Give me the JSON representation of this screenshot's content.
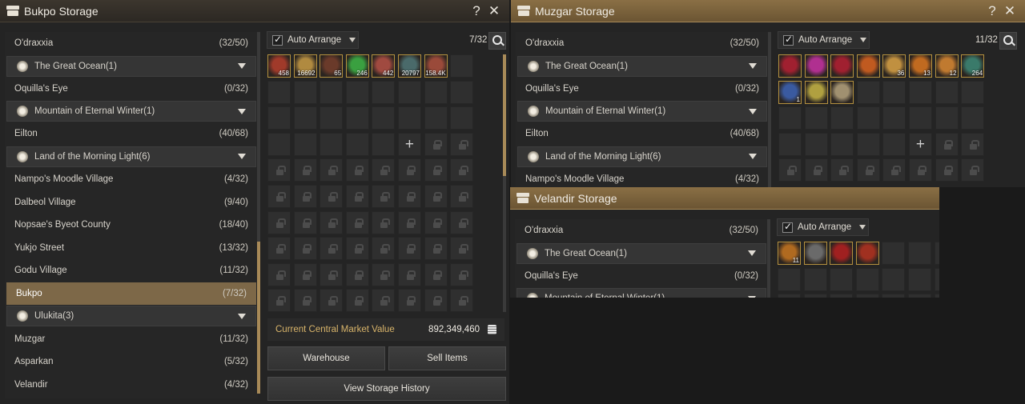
{
  "colors": {
    "accent_gold": "#a88a58",
    "selected_row": "#7d6848",
    "market_label": "#d8b46a"
  },
  "bukpo": {
    "title": "Bukpo Storage",
    "help_icon": "?",
    "close_icon": "✕",
    "rows": [
      {
        "type": "town",
        "name": "O'draxxia",
        "count": "(32/50)"
      },
      {
        "type": "region",
        "name": "The Great Ocean(1)"
      },
      {
        "type": "town",
        "name": "Oquilla's Eye",
        "count": "(0/32)"
      },
      {
        "type": "region",
        "name": "Mountain of Eternal Winter(1)"
      },
      {
        "type": "town",
        "name": "Eilton",
        "count": "(40/68)"
      },
      {
        "type": "region",
        "name": "Land of the Morning Light(6)"
      },
      {
        "type": "town",
        "name": "Nampo's Moodle Village",
        "count": "(4/32)"
      },
      {
        "type": "town",
        "name": "Dalbeol Village",
        "count": "(9/40)"
      },
      {
        "type": "town",
        "name": "Nopsae's Byeot County",
        "count": "(18/40)"
      },
      {
        "type": "town",
        "name": "Yukjo Street",
        "count": "(13/32)"
      },
      {
        "type": "town",
        "name": "Godu Village",
        "count": "(11/32)"
      },
      {
        "type": "town",
        "name": "Bukpo",
        "count": "(7/32)",
        "selected": true
      },
      {
        "type": "region",
        "name": "Ulukita(3)"
      },
      {
        "type": "town",
        "name": "Muzgar",
        "count": "(11/32)"
      },
      {
        "type": "town",
        "name": "Asparkan",
        "count": "(5/32)"
      },
      {
        "type": "town",
        "name": "Velandir",
        "count": "(4/32)"
      }
    ],
    "auto_arrange": "Auto Arrange",
    "capacity": "7/32",
    "items": [
      {
        "qty": "458",
        "color": "#a03a2a"
      },
      {
        "qty": "16692",
        "color": "#b08a40"
      },
      {
        "qty": "65",
        "color": "#6a3a2a"
      },
      {
        "qty": "246",
        "color": "#3aa040"
      },
      {
        "qty": "442",
        "color": "#a04a40"
      },
      {
        "qty": "20797",
        "color": "#4a6a6a"
      },
      {
        "qty": "158.4K",
        "color": "#9a4a3a"
      }
    ],
    "market_label": "Current Central Market Value",
    "market_value": "892,349,460",
    "warehouse_btn": "Warehouse",
    "sell_btn": "Sell Items",
    "history_btn": "View Storage History"
  },
  "muzgar": {
    "title": "Muzgar Storage",
    "help_icon": "?",
    "close_icon": "✕",
    "rows": [
      {
        "type": "town",
        "name": "O'draxxia",
        "count": "(32/50)"
      },
      {
        "type": "region",
        "name": "The Great Ocean(1)"
      },
      {
        "type": "town",
        "name": "Oquilla's Eye",
        "count": "(0/32)"
      },
      {
        "type": "region",
        "name": "Mountain of Eternal Winter(1)"
      },
      {
        "type": "town",
        "name": "Eilton",
        "count": "(40/68)"
      },
      {
        "type": "region",
        "name": "Land of the Morning Light(6)"
      },
      {
        "type": "town",
        "name": "Nampo's Moodle Village",
        "count": "(4/32)"
      }
    ],
    "auto_arrange": "Auto Arrange",
    "capacity": "11/32",
    "items": [
      {
        "qty": "",
        "color": "#a02030"
      },
      {
        "qty": "",
        "color": "#b03090"
      },
      {
        "qty": "",
        "color": "#a02030"
      },
      {
        "qty": "",
        "color": "#c05a20"
      },
      {
        "qty": "36",
        "color": "#c09040"
      },
      {
        "qty": "13",
        "color": "#c06a20"
      },
      {
        "qty": "12",
        "color": "#c07a30"
      },
      {
        "qty": "264",
        "color": "#3a7a6a"
      },
      {
        "qty": "1",
        "color": "#3a5aa0"
      },
      {
        "qty": "",
        "color": "#b0a040"
      },
      {
        "qty": "",
        "color": "#a09070"
      }
    ]
  },
  "velandir": {
    "title": "Velandir Storage",
    "rows": [
      {
        "type": "town",
        "name": "O'draxxia",
        "count": "(32/50)"
      },
      {
        "type": "region",
        "name": "The Great Ocean(1)"
      },
      {
        "type": "town",
        "name": "Oquilla's Eye",
        "count": "(0/32)"
      },
      {
        "type": "region",
        "name": "Mountain of Eternal Winter(1)"
      }
    ],
    "auto_arrange": "Auto Arrange",
    "items": [
      {
        "qty": "11",
        "color": "#b06a20"
      },
      {
        "qty": "",
        "color": "#6a6a6a"
      },
      {
        "qty": "",
        "color": "#a02020"
      },
      {
        "qty": "",
        "color": "#a03020"
      }
    ]
  }
}
